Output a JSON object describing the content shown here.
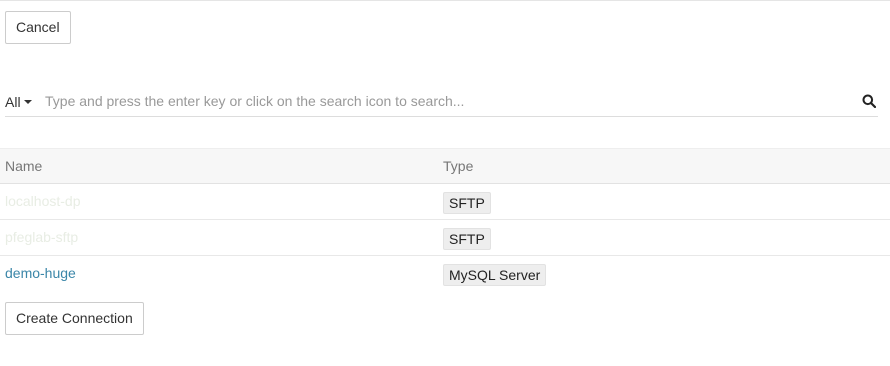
{
  "toolbar": {
    "cancel_label": "Cancel"
  },
  "search": {
    "filter_value": "All",
    "placeholder": "Type and press the enter key or click on the search icon to search...",
    "value": ""
  },
  "table": {
    "columns": [
      "Name",
      "Type"
    ],
    "rows": [
      {
        "name": "localhost-dp",
        "type": "SFTP"
      },
      {
        "name": "pfeglab-sftp",
        "type": "SFTP"
      },
      {
        "name": "demo-huge",
        "type": "MySQL Server"
      }
    ]
  },
  "footer": {
    "create_label": "Create Connection"
  },
  "colors": {
    "link": "#3a86a8",
    "header_bg": "#f7f7f7"
  }
}
